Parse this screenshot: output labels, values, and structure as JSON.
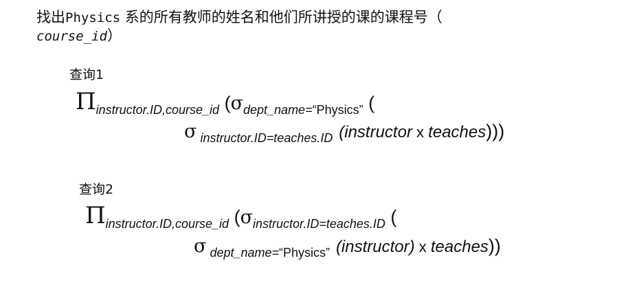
{
  "question": {
    "prefix": "找出",
    "dept": "Physics",
    "middle": " 系的所有教师的姓名和他们所讲授的课的课程号（",
    "field": "course_id",
    "suffix": "）"
  },
  "query1": {
    "label": "查询1",
    "pi": "Π",
    "pi_sub": "instructor.ID,course_id",
    "open1": " (",
    "sigma": "σ",
    "sigma_sub": "dept_name=",
    "sigma_val": "“Physics”",
    "open2": " (",
    "sigma2": "σ",
    "sigma2_sub": " instructor.ID=teaches.ID",
    "rel1": "(instructor",
    "times": " x ",
    "rel2": "teaches",
    "close": ")))"
  },
  "query2": {
    "label": "查询2",
    "pi": "Π",
    "pi_sub": "instructor.ID,course_id",
    "open1": " (",
    "sigma": "σ",
    "sigma_sub": "instructor.ID=teaches.ID",
    "open2": " (",
    "sigma2": "σ",
    "sigma2_sub": " dept_name=",
    "sigma2_val": "“Physics”",
    "rel1": "(instructor)",
    "times": " x ",
    "rel2": "teaches",
    "close": "))"
  }
}
